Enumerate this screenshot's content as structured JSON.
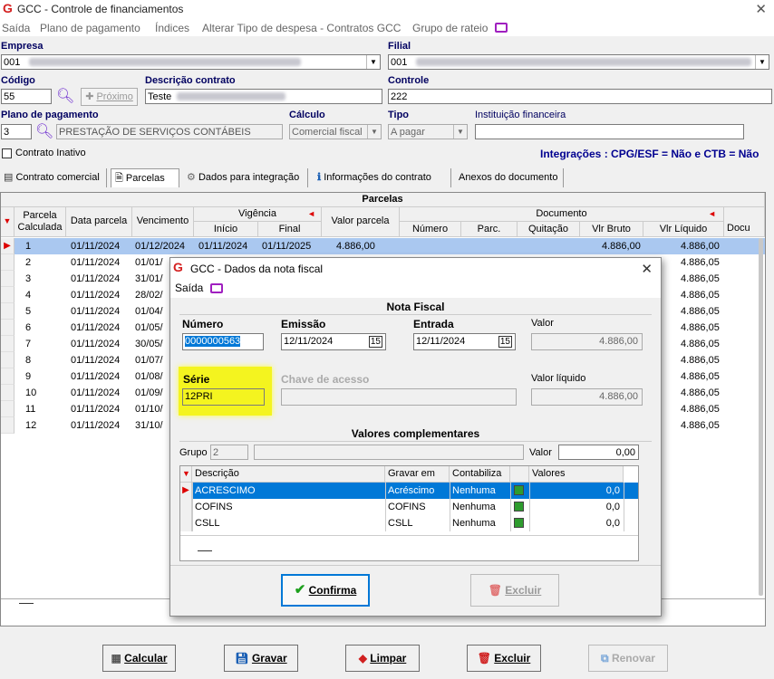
{
  "window": {
    "title": "GCC - Controle de financiamentos"
  },
  "menu": [
    "Saída",
    "Plano de pagamento",
    "Índices",
    "Alterar Tipo de despesa - Contratos GCC",
    "Grupo de rateio"
  ],
  "form": {
    "empresa_label": "Empresa",
    "empresa_value": "001",
    "filial_label": "Filial",
    "filial_value": "001",
    "codigo_label": "Código",
    "codigo_value": "55",
    "proximo_label": "Próximo",
    "descricao_label": "Descrição contrato",
    "descricao_value": "Teste",
    "controle_label": "Controle",
    "controle_value": "222",
    "plano_label": "Plano de pagamento",
    "plano_code": "3",
    "plano_value": "PRESTAÇÃO DE SERVIÇOS CONTÁBEIS",
    "calculo_label": "Cálculo",
    "calculo_value": "Comercial fiscal",
    "tipo_label": "Tipo",
    "tipo_value": "A pagar",
    "instituicao_label": "Instituição financeira",
    "inativo_label": "Contrato Inativo",
    "integracoes": "Integrações : CPG/ESF = Não e CTB = Não"
  },
  "tabs": [
    "Contrato comercial",
    "Parcelas",
    "Dados para integração",
    "Informações do contrato",
    "Anexos do documento"
  ],
  "grid": {
    "title": "Parcelas",
    "headers": {
      "parcela": "Parcela Calculada",
      "data": "Data parcela",
      "venc": "Vencimento",
      "vigencia": "Vigência",
      "inicio": "Início",
      "final": "Final",
      "valor": "Valor parcela",
      "documento": "Documento",
      "numero": "Número",
      "parc": "Parc.",
      "quitacao": "Quitação",
      "bruto": "Vlr Bruto",
      "liquido": "Vlr Líquido",
      "docu": "Docu"
    },
    "rows": [
      {
        "n": "1",
        "data": "01/11/2024",
        "venc": "01/12/2024",
        "inicio": "01/11/2024",
        "final": "01/11/2025",
        "valor": "4.886,00",
        "bruto": "4.886,00",
        "liquido": "4.886,00"
      },
      {
        "n": "2",
        "data": "01/11/2024",
        "venc": "01/01/",
        "liquido": "4.886,05"
      },
      {
        "n": "3",
        "data": "01/11/2024",
        "venc": "31/01/",
        "liquido": "4.886,05"
      },
      {
        "n": "4",
        "data": "01/11/2024",
        "venc": "28/02/",
        "liquido": "4.886,05"
      },
      {
        "n": "5",
        "data": "01/11/2024",
        "venc": "01/04/",
        "liquido": "4.886,05"
      },
      {
        "n": "6",
        "data": "01/11/2024",
        "venc": "01/05/",
        "liquido": "4.886,05"
      },
      {
        "n": "7",
        "data": "01/11/2024",
        "venc": "30/05/",
        "liquido": "4.886,05"
      },
      {
        "n": "8",
        "data": "01/11/2024",
        "venc": "01/07/",
        "liquido": "4.886,05"
      },
      {
        "n": "9",
        "data": "01/11/2024",
        "venc": "01/08/",
        "liquido": "4.886,05"
      },
      {
        "n": "10",
        "data": "01/11/2024",
        "venc": "01/09/",
        "liquido": "4.886,05"
      },
      {
        "n": "11",
        "data": "01/11/2024",
        "venc": "01/10/",
        "liquido": "4.886,05"
      },
      {
        "n": "12",
        "data": "01/11/2024",
        "venc": "31/10/",
        "liquido": "4.886,05"
      }
    ]
  },
  "modal": {
    "title": "GCC - Dados da nota fiscal",
    "saida": "Saída",
    "nota_title": "Nota Fiscal",
    "numero_label": "Número",
    "numero_value": "0000000563",
    "emissao_label": "Emissão",
    "emissao_value": "12/11/2024",
    "entrada_label": "Entrada",
    "entrada_value": "12/11/2024",
    "valor_label": "Valor",
    "valor_value": "4.886,00",
    "serie_label": "Série",
    "serie_value": "12PRI",
    "chave_label": "Chave de acesso",
    "liquido_label": "Valor líquido",
    "liquido_value": "4.886,00",
    "comp_title": "Valores complementares",
    "grupo_label": "Grupo",
    "grupo_value": "2",
    "valor2_label": "Valor",
    "valor2_value": "0,00",
    "grid_headers": {
      "desc": "Descrição",
      "gravar": "Gravar em",
      "cont": "Contabiliza",
      "valores": "Valores"
    },
    "grid_rows": [
      {
        "desc": "ACRESCIMO",
        "gravar": "Acréscimo",
        "cont": "Nenhuma",
        "valor": "0,0"
      },
      {
        "desc": "COFINS",
        "gravar": "COFINS",
        "cont": "Nenhuma",
        "valor": "0,0"
      },
      {
        "desc": "CSLL",
        "gravar": "CSLL",
        "cont": "Nenhuma",
        "valor": "0,0"
      }
    ],
    "confirma": "Confirma",
    "excluir": "Excluir"
  },
  "buttons": {
    "calcular": "Calcular",
    "gravar": "Gravar",
    "limpar": "Limpar",
    "excluir": "Excluir",
    "renovar": "Renovar"
  }
}
